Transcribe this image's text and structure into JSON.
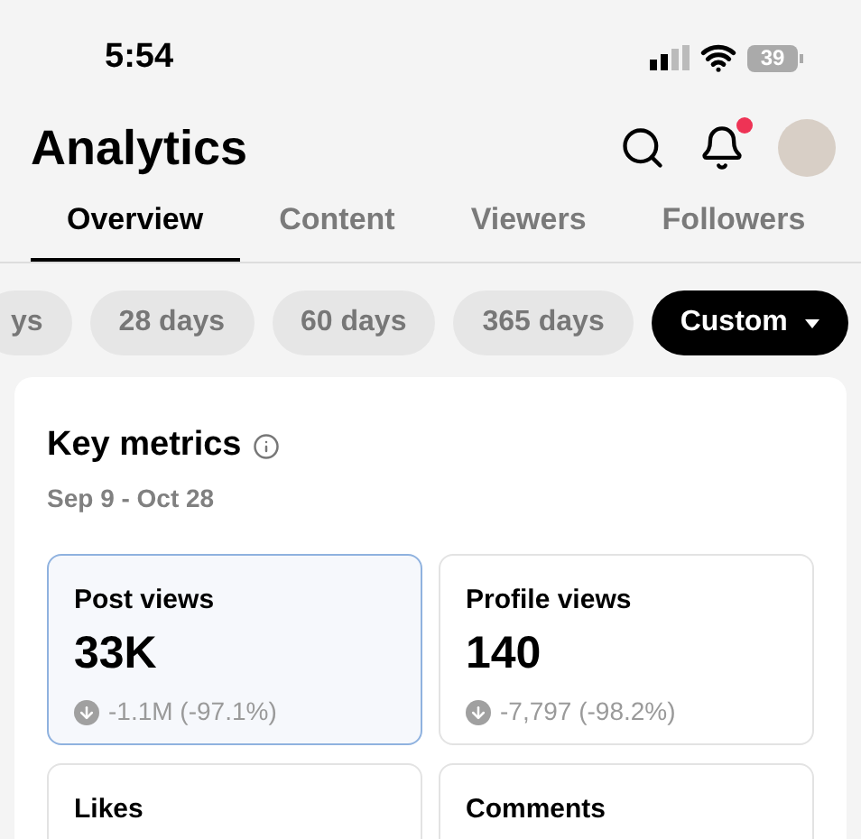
{
  "status_bar": {
    "time": "5:54",
    "battery": "39"
  },
  "header": {
    "title": "Analytics",
    "notification_dot": true
  },
  "tabs": [
    {
      "label": "Overview",
      "selected": true
    },
    {
      "label": "Content",
      "selected": false
    },
    {
      "label": "Viewers",
      "selected": false
    },
    {
      "label": "Followers",
      "selected": false
    }
  ],
  "ranges": [
    {
      "label": "ys",
      "selected": false,
      "kind": "chip"
    },
    {
      "label": "28 days",
      "selected": false,
      "kind": "chip"
    },
    {
      "label": "60 days",
      "selected": false,
      "kind": "chip"
    },
    {
      "label": "365 days",
      "selected": false,
      "kind": "chip"
    },
    {
      "label": "Custom",
      "selected": true,
      "kind": "dropdown"
    }
  ],
  "key_metrics": {
    "title": "Key metrics",
    "date_range": "Sep 9 - Oct 28",
    "metrics": [
      {
        "label": "Post views",
        "value": "33K",
        "change": "-1.1M (-97.1%)",
        "selected": true
      },
      {
        "label": "Profile views",
        "value": "140",
        "change": "-7,797 (-98.2%)",
        "selected": false
      },
      {
        "label": "Likes",
        "selected": false
      },
      {
        "label": "Comments",
        "selected": false
      }
    ]
  }
}
